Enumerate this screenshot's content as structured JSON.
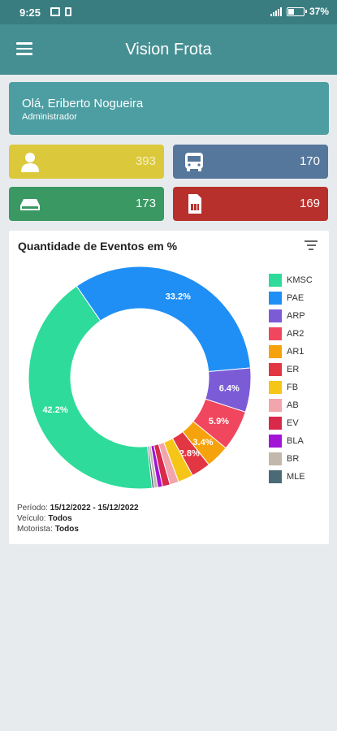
{
  "status_bar": {
    "time": "9:25",
    "battery": "37%",
    "battery_level": 0.37
  },
  "app_bar": {
    "title": "Vision Frota"
  },
  "welcome": {
    "greeting": "Olá, Eriberto Nogueira",
    "role": "Administrador"
  },
  "stats": [
    {
      "icon": "user-icon",
      "value": "393",
      "color": "#dcc93b"
    },
    {
      "icon": "bus-icon",
      "value": "170",
      "color": "#55779b"
    },
    {
      "icon": "device-icon",
      "value": "173",
      "color": "#3a9963"
    },
    {
      "icon": "sim-card-icon",
      "value": "169",
      "color": "#b8302b"
    }
  ],
  "chart_card": {
    "title": "Quantidade de Eventos em %",
    "period_label": "Período:",
    "period_value": "15/12/2022 - 15/12/2022",
    "vehicle_label": "Veículo:",
    "vehicle_value": "Todos",
    "driver_label": "Motorista:",
    "driver_value": "Todos"
  },
  "chart_data": {
    "type": "pie",
    "donut": true,
    "title": "Quantidade de Eventos em %",
    "legend_position": "right",
    "series": [
      {
        "name": "KMSC",
        "value": 42.2,
        "label": "42.2%",
        "color": "#2edb9a"
      },
      {
        "name": "PAE",
        "value": 33.2,
        "label": "33.2%",
        "color": "#1f8ff5"
      },
      {
        "name": "ARP",
        "value": 6.4,
        "label": "6.4%",
        "color": "#7b5cd6"
      },
      {
        "name": "AR2",
        "value": 5.9,
        "label": "5.9%",
        "color": "#f0465e"
      },
      {
        "name": "AR1",
        "value": 3.4,
        "label": "3.4%",
        "color": "#f6a20c"
      },
      {
        "name": "ER",
        "value": 2.8,
        "label": "2.8%",
        "color": "#e33643"
      },
      {
        "name": "FB",
        "value": 2.2,
        "label": "",
        "color": "#f5c518"
      },
      {
        "name": "AB",
        "value": 1.3,
        "label": "",
        "color": "#f2a5ac"
      },
      {
        "name": "EV",
        "value": 1.1,
        "label": "",
        "color": "#d92a4c"
      },
      {
        "name": "BLA",
        "value": 0.7,
        "label": "",
        "color": "#a315d6"
      },
      {
        "name": "BR",
        "value": 0.5,
        "label": "",
        "color": "#c2b8ac"
      },
      {
        "name": "MLE",
        "value": 0.3,
        "label": "",
        "color": "#4a6b75"
      }
    ]
  }
}
